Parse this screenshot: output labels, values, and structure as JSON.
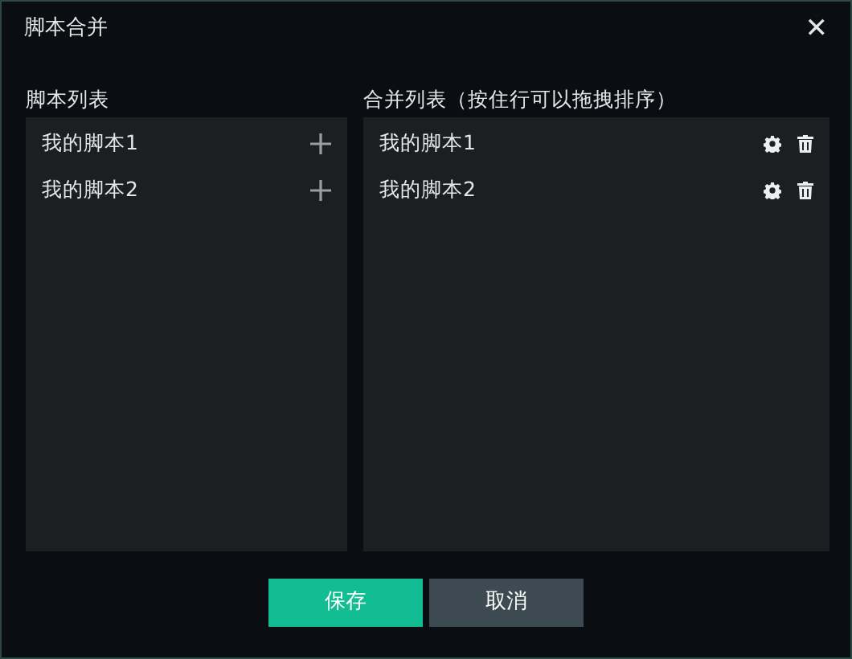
{
  "window": {
    "title": "脚本合并",
    "close": "✕"
  },
  "script_list": {
    "label": "脚本列表",
    "items": [
      {
        "name": "我的脚本1"
      },
      {
        "name": "我的脚本2"
      }
    ]
  },
  "merge_list": {
    "label": "合并列表（按住行可以拖拽排序）",
    "items": [
      {
        "name": "我的脚本1"
      },
      {
        "name": "我的脚本2"
      }
    ]
  },
  "buttons": [
    {
      "label": "保存",
      "kind": "primary"
    },
    {
      "label": "取消",
      "kind": "secondary"
    }
  ]
}
